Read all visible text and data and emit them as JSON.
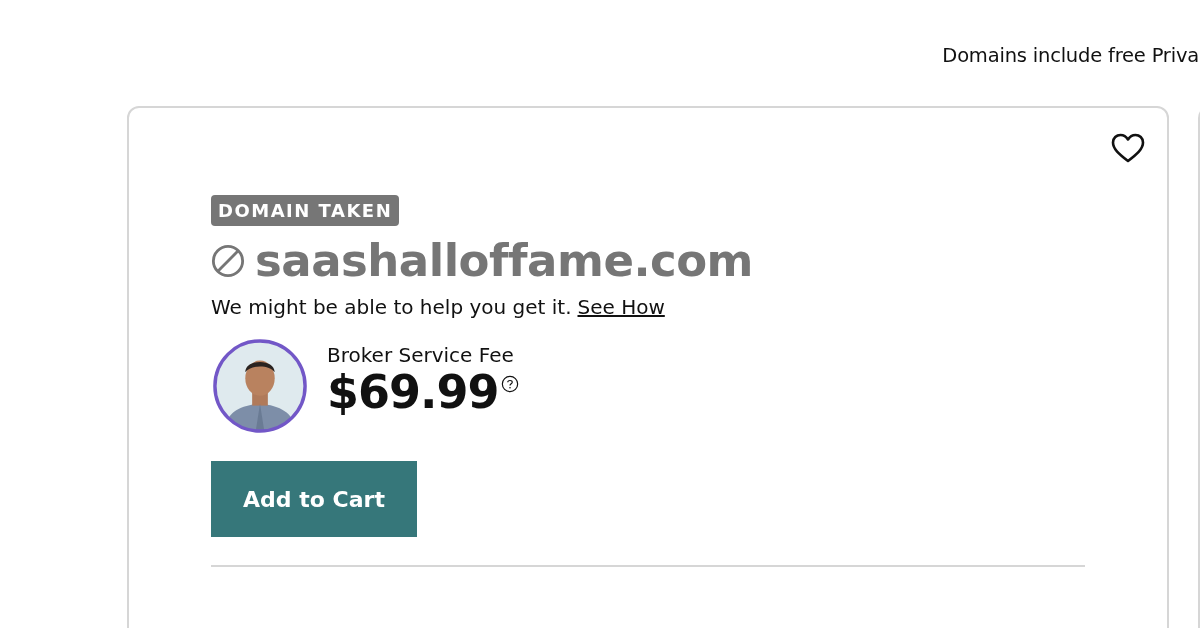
{
  "notice": "Domains include free Priva",
  "result": {
    "saved": false,
    "badge": "DOMAIN TAKEN",
    "domain": "saashalloffame.com",
    "help_text": "We might be able to help you get it.",
    "help_link": "See How",
    "fee_label": "Broker Service Fee",
    "price": "$69.99",
    "button": "Add to Cart"
  }
}
